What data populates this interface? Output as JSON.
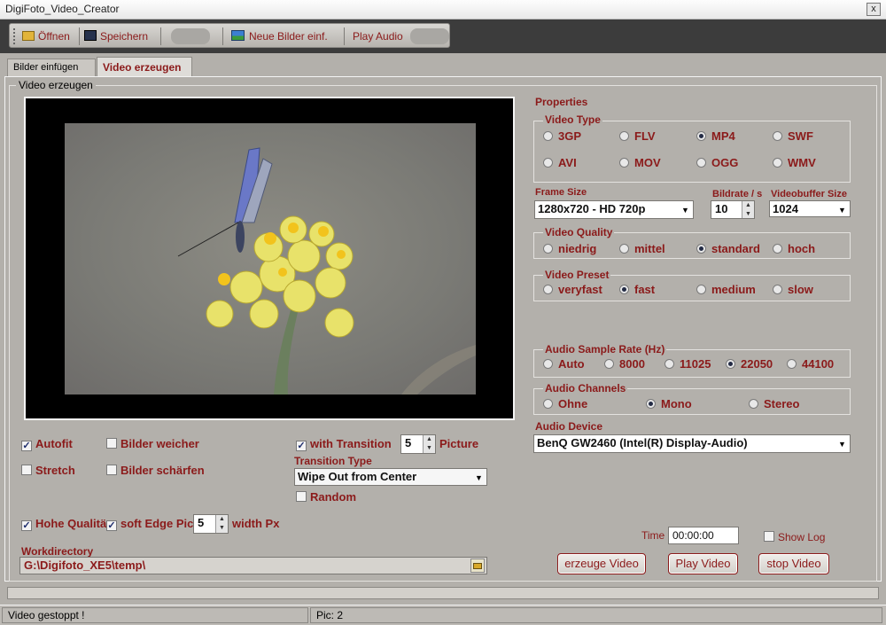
{
  "window": {
    "title": "DigiFoto_Video_Creator",
    "close": "x"
  },
  "toolbar": {
    "open": "Öffnen",
    "save": "Speichern",
    "add_images": "Neue Bilder einf.",
    "play_audio": "Play Audio"
  },
  "tabs": [
    "Bilder einfügen",
    "Video erzeugen"
  ],
  "video_group": "Video erzeugen",
  "properties": {
    "title": "Properties",
    "video_type": {
      "title": "Video Type",
      "options": [
        "3GP",
        "FLV",
        "MP4",
        "SWF",
        "AVI",
        "MOV",
        "OGG",
        "WMV"
      ],
      "selected": "MP4"
    },
    "frame_size": {
      "label": "Frame Size",
      "value": "1280x720 - HD 720p"
    },
    "bitrate": {
      "label": "Bildrate / s",
      "value": "10"
    },
    "videobuffer": {
      "label": "Videobuffer Size",
      "value": "1024"
    },
    "video_quality": {
      "title": "Video Quality",
      "options": [
        "niedrig",
        "mittel",
        "standard",
        "hoch"
      ],
      "selected": "standard"
    },
    "video_preset": {
      "title": "Video Preset",
      "options": [
        "veryfast",
        "fast",
        "medium",
        "slow"
      ],
      "selected": "fast"
    },
    "audio_sample_rate": {
      "title": "Audio Sample Rate (Hz)",
      "options": [
        "Auto",
        "8000",
        "11025",
        "22050",
        "44100"
      ],
      "selected": "22050"
    },
    "audio_channels": {
      "title": "Audio Channels",
      "options": [
        "Ohne",
        "Mono",
        "Stereo"
      ],
      "selected": "Mono"
    },
    "audio_device": {
      "label": "Audio Device",
      "value": "BenQ GW2460 (Intel(R) Display-Audio)"
    }
  },
  "options": {
    "autofit": "Autofit",
    "soften": "Bilder weicher",
    "stretch": "Stretch",
    "sharpen": "Bilder schärfen",
    "with_transition": "with Transition",
    "transition_value": "5",
    "picture": "Picture",
    "transition_type_label": "Transition Type",
    "transition_type": "Wipe Out from Center",
    "random": "Random",
    "high_quality": "Hohe Qualität",
    "soft_edge": "soft Edge Pic",
    "soft_edge_value": "5",
    "width_px": "width Px"
  },
  "workdir": {
    "label": "Workdirectory",
    "value": "G:\\Digifoto_XE5\\temp\\"
  },
  "time": {
    "label": "Time",
    "value": "00:00:00"
  },
  "show_log": "Show Log",
  "buttons": {
    "create": "erzeuge Video",
    "play": "Play Video",
    "stop": "stop Video"
  },
  "status": {
    "message": "Video gestoppt !",
    "pic": "Pic:  2"
  }
}
